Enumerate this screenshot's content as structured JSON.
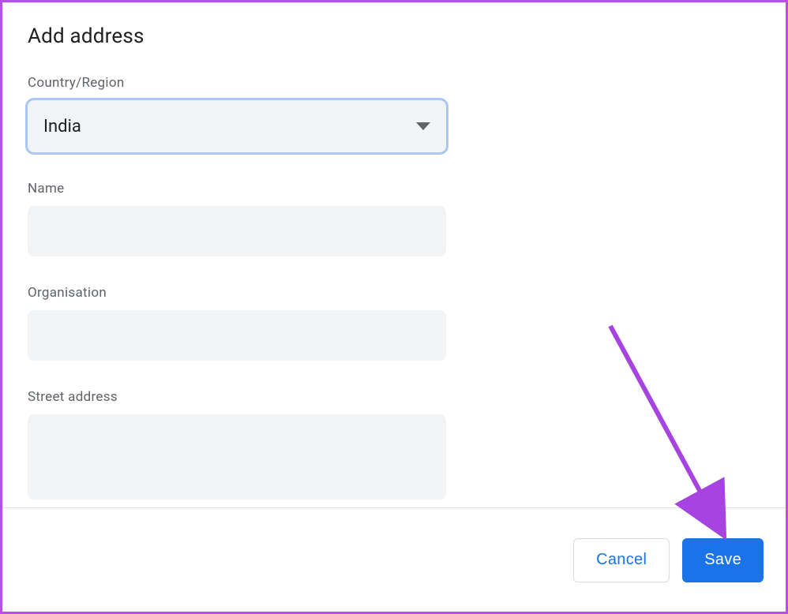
{
  "heading": "Add address",
  "fields": {
    "country": {
      "label": "Country/Region",
      "value": "India"
    },
    "name": {
      "label": "Name",
      "value": ""
    },
    "organisation": {
      "label": "Organisation",
      "value": ""
    },
    "street": {
      "label": "Street address",
      "value": ""
    }
  },
  "buttons": {
    "cancel": "Cancel",
    "save": "Save"
  },
  "colors": {
    "accent": "#1a73e8",
    "arrow": "#a743e0",
    "border": "#b94fe8"
  }
}
